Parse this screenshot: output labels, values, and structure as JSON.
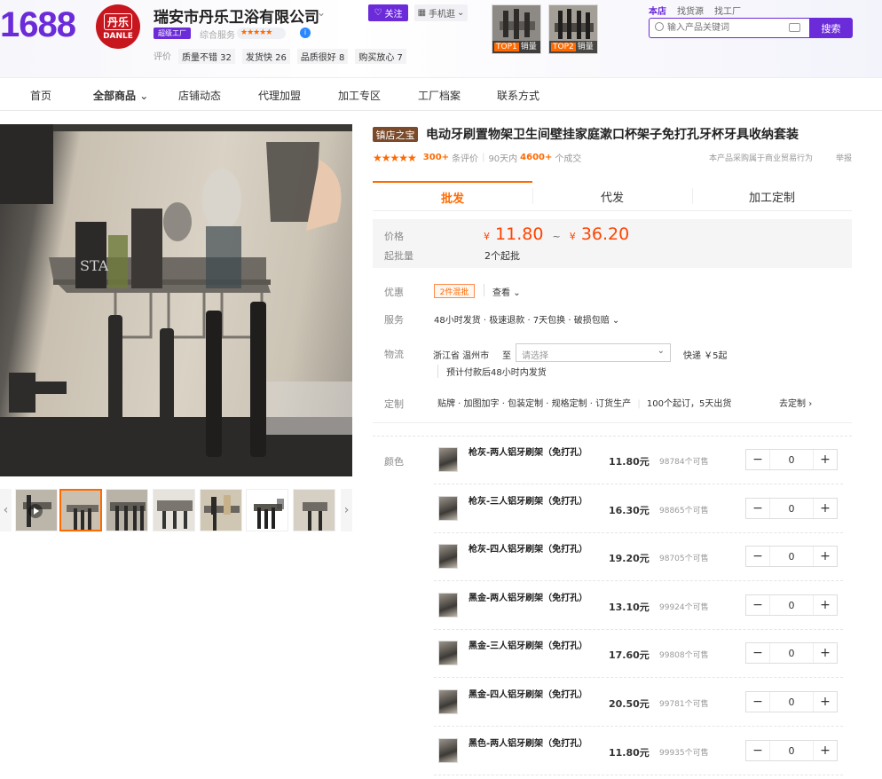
{
  "header": {
    "site_logo": "1688",
    "shop_logo_cn": "丹乐",
    "shop_logo_en": "DANLE",
    "shop_name": "瑞安市丹乐卫浴有限公司",
    "follow_label": "关注",
    "mobile_label": "手机逛",
    "super_factory_badge": "超级工厂",
    "service_score_label": "综合服务",
    "service_stars": "★★★★★",
    "rating_label": "评价",
    "rating_tags": [
      "质量不错 32",
      "发货快 26",
      "品质很好 8",
      "购买放心 7"
    ],
    "top_products": [
      {
        "rank": "TOP1",
        "label": "销量"
      },
      {
        "rank": "TOP2",
        "label": "销量"
      }
    ],
    "search_tabs": [
      "本店",
      "找货源",
      "找工厂"
    ],
    "search_placeholder": "输入产品关键词",
    "search_button": "搜索"
  },
  "nav": {
    "items": [
      "首页",
      "全部商品",
      "店铺动态",
      "代理加盟",
      "加工专区",
      "工厂档案",
      "联系方式"
    ]
  },
  "product": {
    "badge": "镇店之宝",
    "title": "电动牙刷置物架卫生间壁挂家庭漱口杯架子免打孔牙杯牙具收纳套装",
    "stars": "★★★★★",
    "reviews_count": "300+",
    "reviews_label": "条评价",
    "sold_period": "90天内",
    "sold_count": "4600+",
    "sold_label": "个成交",
    "disclaimer": "本产品采购属于商业贸易行为",
    "report": "举报",
    "tabs": [
      "批发",
      "代发",
      "加工定制"
    ],
    "price_label": "价格",
    "price_min": "11.80",
    "price_max": "36.20",
    "currency": "¥",
    "moq_label": "起批量",
    "moq_value": "2个起批",
    "promo_label": "优惠",
    "promo_tag": "2件混批",
    "promo_view": "查看",
    "service_label": "服务",
    "service_text": "48小时发货 · 极速退款 · 7天包换 · 破损包赔",
    "logistics_label": "物流",
    "ship_from": "浙江省 温州市",
    "ship_to_label": "至",
    "region_placeholder": "请选择",
    "ship_method": "快递 ￥5起",
    "ship_estimate": "预计付款后48小时内发货",
    "custom_label": "定制",
    "custom_text": "贴牌 · 加图加字 · 包装定制 · 规格定制 · 订货生产",
    "custom_moq": "100个起订，5天出货",
    "custom_link": "去定制",
    "color_label": "颜色",
    "skus": [
      {
        "name": "枪灰-两人铝牙刷架（免打孔）",
        "price": "11.80元",
        "stock": "98784个可售",
        "qty": "0"
      },
      {
        "name": "枪灰-三人铝牙刷架（免打孔）",
        "price": "16.30元",
        "stock": "98865个可售",
        "qty": "0"
      },
      {
        "name": "枪灰-四人铝牙刷架（免打孔）",
        "price": "19.20元",
        "stock": "98705个可售",
        "qty": "0"
      },
      {
        "name": "黑金-两人铝牙刷架（免打孔）",
        "price": "13.10元",
        "stock": "99924个可售",
        "qty": "0"
      },
      {
        "name": "黑金-三人铝牙刷架（免打孔）",
        "price": "17.60元",
        "stock": "99808个可售",
        "qty": "0"
      },
      {
        "name": "黑金-四人铝牙刷架（免打孔）",
        "price": "20.50元",
        "stock": "99781个可售",
        "qty": "0"
      },
      {
        "name": "黑色-两人铝牙刷架（免打孔）",
        "price": "11.80元",
        "stock": "99935个可售",
        "qty": "0"
      }
    ]
  },
  "colors": {
    "brand_purple": "#6b2bd9",
    "accent_orange": "#ff6a00",
    "price_red": "#ff4400"
  }
}
